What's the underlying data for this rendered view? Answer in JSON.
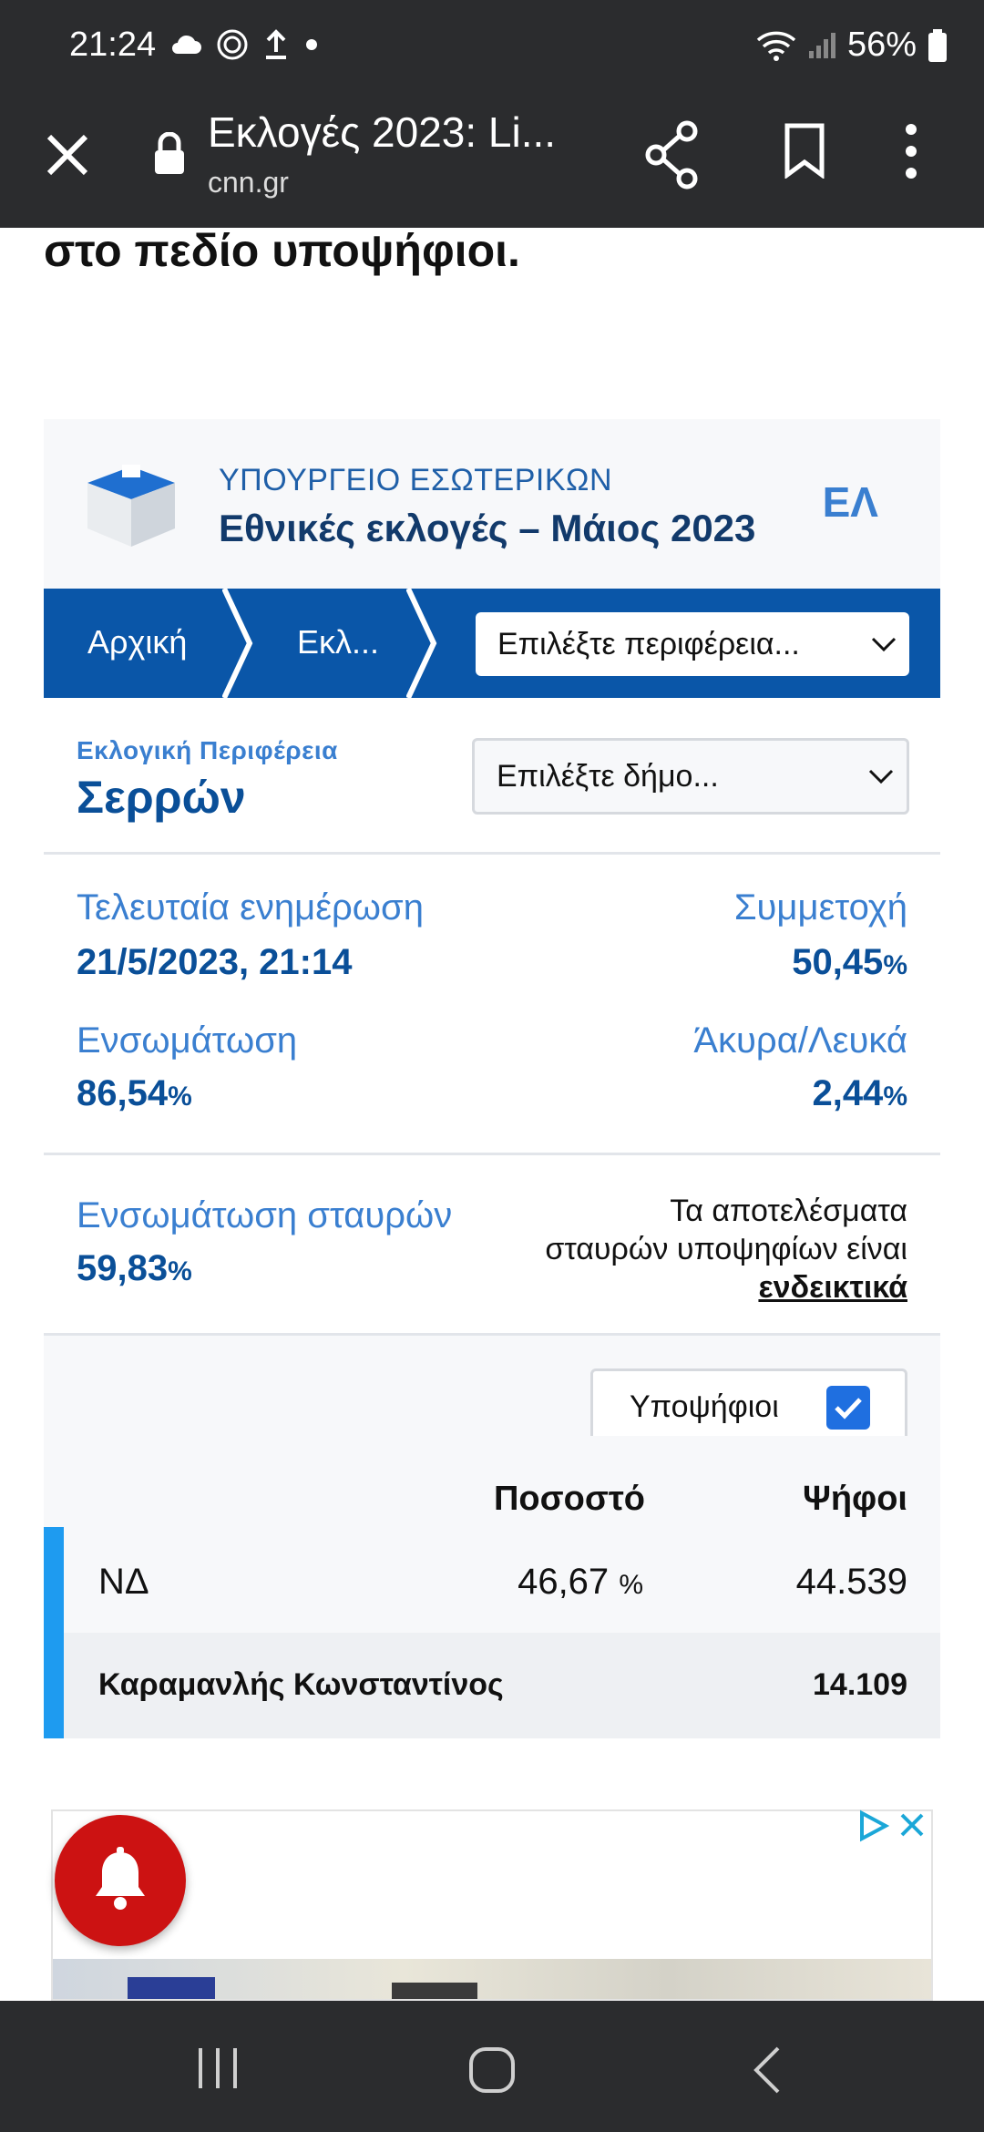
{
  "status_bar": {
    "time": "21:24",
    "battery": "56%"
  },
  "browser": {
    "title": "Εκλογές 2023: Li...",
    "domain": "cnn.gr"
  },
  "article": {
    "text_fragment": "στο πεδίο υποψήφιοι."
  },
  "widget": {
    "ministry": "ΥΠΟΥΡΓΕΙΟ ΕΣΩΤΕΡΙΚΩΝ",
    "election_title": "Εθνικές εκλογές – Μάιος 2023",
    "language": "ΕΛ",
    "breadcrumb": {
      "home": "Αρχική",
      "elections": "Εκλ...",
      "region_select": "Επιλέξτε περιφέρεια..."
    },
    "region": {
      "label": "Εκλογική Περιφέρεια",
      "name": "Σερρών",
      "municipality_select": "Επιλέξτε δήμο..."
    },
    "stats": {
      "last_update_label": "Τελευταία ενημέρωση",
      "last_update_value": "21/5/2023, 21:14",
      "turnout_label": "Συμμετοχή",
      "turnout_value": "50,45",
      "integration_label": "Ενσωμάτωση",
      "integration_value": "86,54",
      "invalid_label": "Άκυρα/Λευκά",
      "invalid_value": "2,44",
      "percent_sign": "%"
    },
    "cross": {
      "label": "Ενσωμάτωση σταυρών",
      "value": "59,83",
      "note_line1": "Τα αποτελέσματα",
      "note_line2": "σταυρών υποψηφίων είναι",
      "note_emphasis": "ενδεικτικά"
    },
    "candidates_toggle": {
      "label": "Υποψήφιοι",
      "checked": true
    },
    "columns": {
      "percent": "Ποσοστό",
      "votes": "Ψήφοι"
    },
    "party": {
      "name": "ΝΔ",
      "percent": "46,67",
      "percent_sign": "%",
      "votes": "44.539"
    },
    "candidate": {
      "name": "Καραμανλής Κωνσταντίνος",
      "votes": "14.109"
    }
  },
  "colors": {
    "accent": "#0a56a8",
    "party_bar": "#1e9bf0",
    "alert": "#cc1212"
  }
}
